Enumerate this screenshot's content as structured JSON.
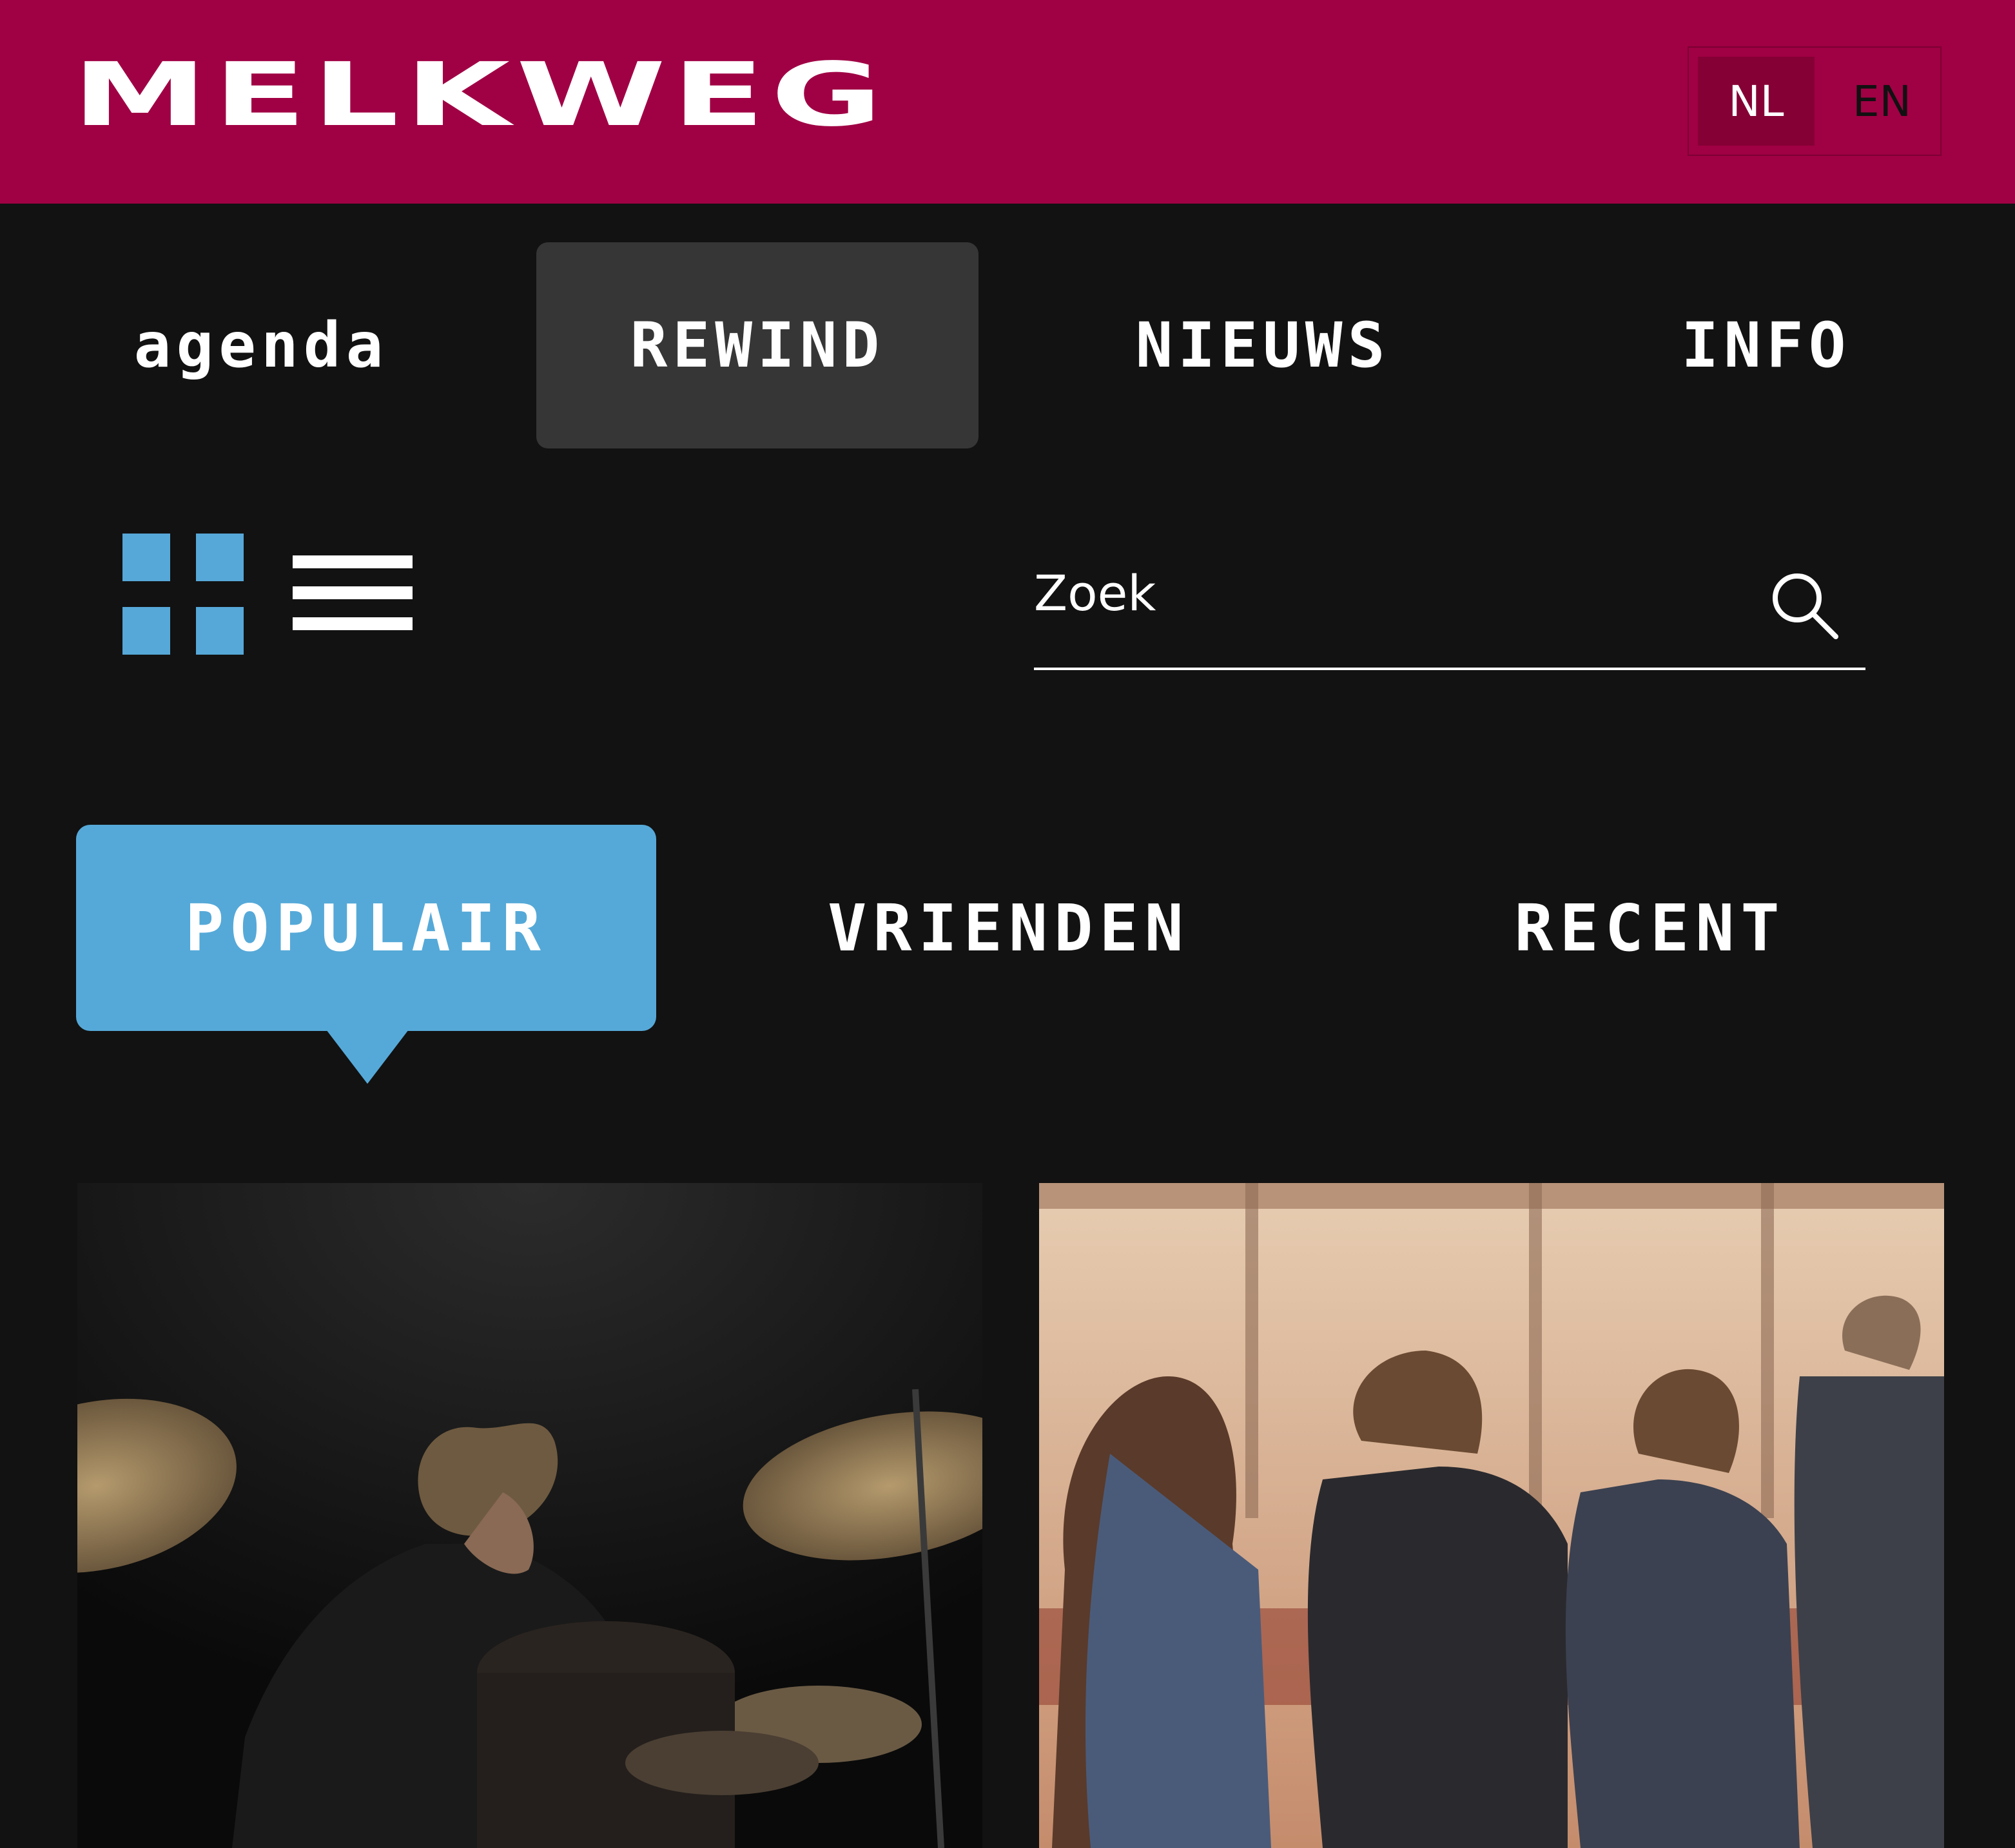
{
  "header": {
    "logo": "MELKWEG",
    "languages": [
      {
        "label": "NL",
        "active": true
      },
      {
        "label": "EN",
        "active": false
      }
    ]
  },
  "nav": {
    "items": [
      {
        "label": "agenda",
        "active": false
      },
      {
        "label": "REWIND",
        "active": true
      },
      {
        "label": "NIEUWS",
        "active": false
      },
      {
        "label": "INFO",
        "active": false
      }
    ]
  },
  "view_toggle": {
    "grid_icon": "grid-icon",
    "list_icon": "list-icon",
    "active": "grid"
  },
  "search": {
    "placeholder": "Zoek",
    "icon": "search-icon"
  },
  "filter": {
    "tabs": [
      {
        "label": "POPULAIR",
        "active": true
      },
      {
        "label": "VRIENDEN",
        "active": false
      },
      {
        "label": "RECENT",
        "active": false
      }
    ]
  },
  "colors": {
    "header_bg": "#a00044",
    "page_bg": "#121212",
    "accent": "#55a9d8",
    "nav_active_bg": "#363636"
  }
}
